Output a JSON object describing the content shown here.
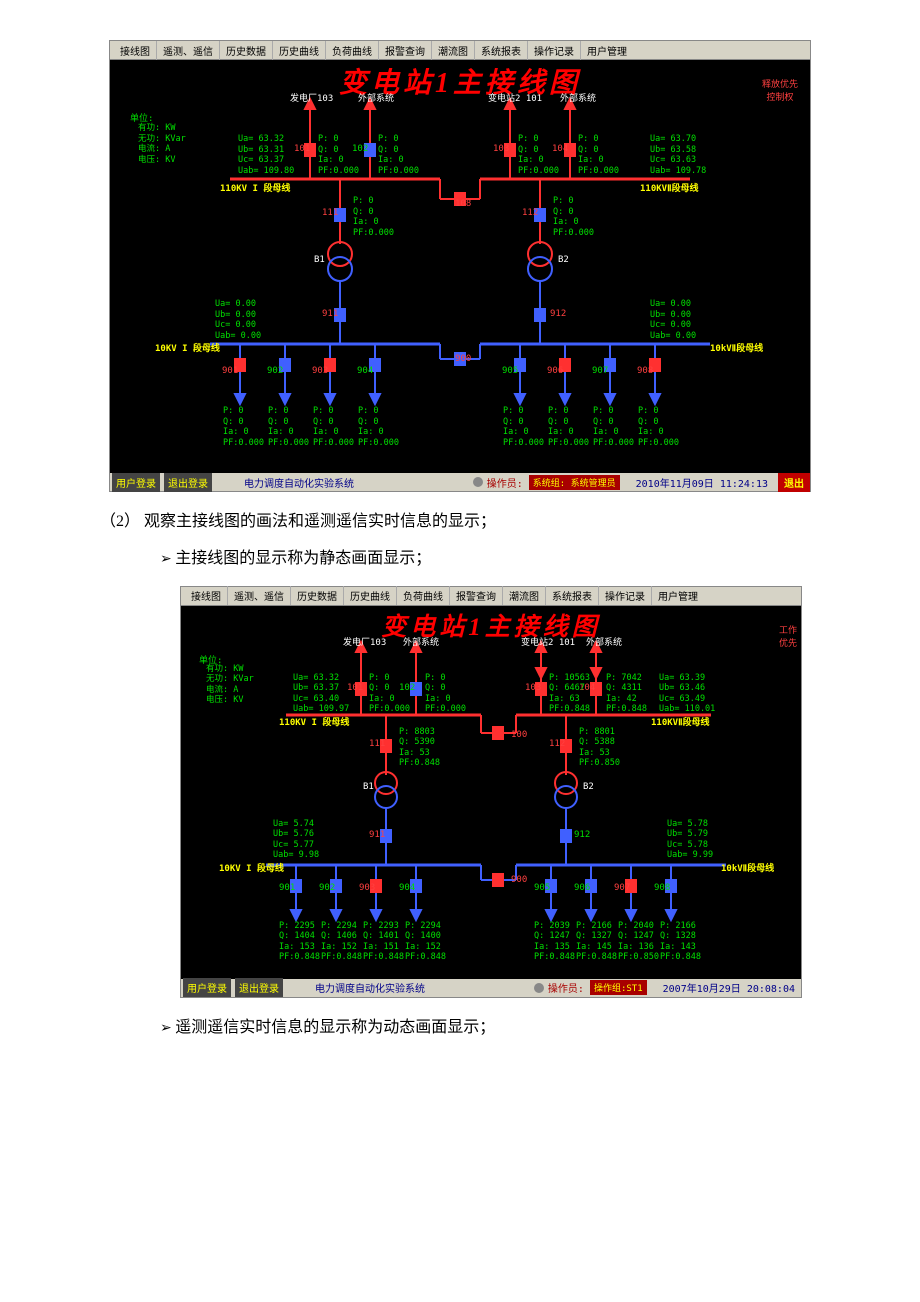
{
  "menu_items": [
    "接线图",
    "遥测、遥信",
    "历史数据",
    "历史曲线",
    "负荷曲线",
    "报警查询",
    "潮流图",
    "系统报表",
    "操作记录",
    "用户管理"
  ],
  "fig_title": "变电站1主接线图",
  "corner_label_1": "释放优先\n控制权",
  "corner_label_2": "工作\n优先",
  "unit_header": "单位:",
  "units": {
    "yg": "有功: KW",
    "wg": "无功: KVar",
    "dl": "电流: A",
    "dy": "电压: KV"
  },
  "source_labels": {
    "s1": "发电厂103",
    "s2": "外部系统",
    "s3": "变电站2 101",
    "s4": "外部系统"
  },
  "bus_labels": {
    "hv1": "110KV I 段母线",
    "hv2": "110KVⅡ段母线",
    "lv1": "10KV I 段母线",
    "lv2": "10kVⅡ段母线"
  },
  "xfmr": {
    "b1": "B1",
    "b2": "B2"
  },
  "line_ids": {
    "l101": "101",
    "l102": "102",
    "l103": "103",
    "l104": "104",
    "tie1": "108",
    "t111": "111",
    "t112": "112",
    "t911": "911",
    "t912": "912",
    "tie2": "900",
    "f901": "901",
    "f902": "902",
    "f903": "903",
    "f904": "904",
    "f905": "905",
    "f906": "906",
    "f907": "907",
    "f908": "908",
    "tie1b": "100"
  },
  "panel1": {
    "vL": {
      "Ua": "Ua= 63.32",
      "Ub": "Ub= 63.31",
      "Uc": "Uc= 63.37",
      "Uab": "Uab= 109.80"
    },
    "vR": {
      "Ua": "Ua= 63.70",
      "Ub": "Ub= 63.58",
      "Uc": "Uc= 63.63",
      "Uab": "Uab= 109.78"
    },
    "zero": {
      "P": "P:   0",
      "Q": "Q:   0",
      "Ia": "Ia:  0",
      "PF": "PF:0.000"
    },
    "vlvL": {
      "Ua": "Ua= 0.00",
      "Ub": "Ub= 0.00",
      "Uc": "Uc= 0.00",
      "Uab": "Uab= 0.00"
    },
    "vlvR": {
      "Ua": "Ua= 0.00",
      "Ub": "Ub= 0.00",
      "Uc": "Uc= 0.00",
      "Uab": "Uab= 0.00"
    },
    "status": {
      "login": "用户登录",
      "logout": "退出登录",
      "sys": "电力调度自动化实验系统",
      "op": "操作员:",
      "opv": "系统组: 系统管理员",
      "time": "2010年11月09日 11:24:13",
      "quit": "退出"
    }
  },
  "panel2": {
    "vL": {
      "Ua": "Ua= 63.32",
      "Ub": "Ub= 63.37",
      "Uc": "Uc= 63.40",
      "Uab": "Uab= 109.97"
    },
    "vR": {
      "Ua": "Ua= 63.39",
      "Ub": "Ub= 63.46",
      "Uc": "Uc= 63.49",
      "Uab": "Uab= 110.01"
    },
    "l103": {
      "P": "P: 10563",
      "Q": "Q: 6467",
      "Ia": "Ia:  63",
      "PF": "PF:0.848"
    },
    "l104": {
      "P": "P: 7042",
      "Q": "Q: 4311",
      "Ia": "Ia:  42",
      "PF": "PF:0.848"
    },
    "l101": {
      "P": "P:   0",
      "Q": "Q:   0",
      "Ia": "Ia:  0",
      "PF": "PF:0.000"
    },
    "l102": {
      "P": "P:   0",
      "Q": "Q:   0",
      "Ia": "Ia:  0",
      "PF": "PF:0.000"
    },
    "t111": {
      "P": "P: 8803",
      "Q": "Q: 5390",
      "Ia": "Ia:  53",
      "PF": "PF:0.848"
    },
    "t112": {
      "P": "P: 8801",
      "Q": "Q: 5388",
      "Ia": "Ia:  53",
      "PF": "PF:0.850"
    },
    "vlvL": {
      "Ua": "Ua= 5.74",
      "Ub": "Ub= 5.76",
      "Uc": "Uc= 5.77",
      "Uab": "Uab= 9.98"
    },
    "vlvR": {
      "Ua": "Ua= 5.78",
      "Ub": "Ub= 5.79",
      "Uc": "Uc= 5.78",
      "Uab": "Uab= 9.99"
    },
    "feeders": {
      "f901": {
        "P": "P: 2295",
        "Q": "Q: 1404",
        "Ia": "Ia: 153",
        "PF": "PF:0.848"
      },
      "f902": {
        "P": "P: 2294",
        "Q": "Q: 1406",
        "Ia": "Ia: 152",
        "PF": "PF:0.848"
      },
      "f903": {
        "P": "P: 2293",
        "Q": "Q: 1401",
        "Ia": "Ia: 151",
        "PF": "PF:0.848"
      },
      "f904": {
        "P": "P: 2294",
        "Q": "Q: 1400",
        "Ia": "Ia: 152",
        "PF": "PF:0.848"
      },
      "f905": {
        "P": "P: 2039",
        "Q": "Q: 1247",
        "Ia": "Ia: 135",
        "PF": "PF:0.848"
      },
      "f906": {
        "P": "P: 2166",
        "Q": "Q: 1327",
        "Ia": "Ia: 145",
        "PF": "PF:0.848"
      },
      "f907": {
        "P": "P: 2040",
        "Q": "Q: 1247",
        "Ia": "Ia: 136",
        "PF": "PF:0.850"
      },
      "f908": {
        "P": "P: 2166",
        "Q": "Q: 1328",
        "Ia": "Ia: 143",
        "PF": "PF:0.848"
      }
    },
    "status": {
      "login": "用户登录",
      "logout": "退出登录",
      "sys": "电力调度自动化实验系统",
      "op": "操作员:",
      "opv": "操作组:ST1",
      "time": "2007年10月29日 20:08:04",
      "quit": ""
    }
  },
  "body_text": {
    "p1": "（2）   观察主接线图的画法和遥测遥信实时信息的显示；",
    "b1": "主接线图的显示称为静态画面显示；",
    "b2": "遥测遥信实时信息的显示称为动态画面显示；"
  }
}
